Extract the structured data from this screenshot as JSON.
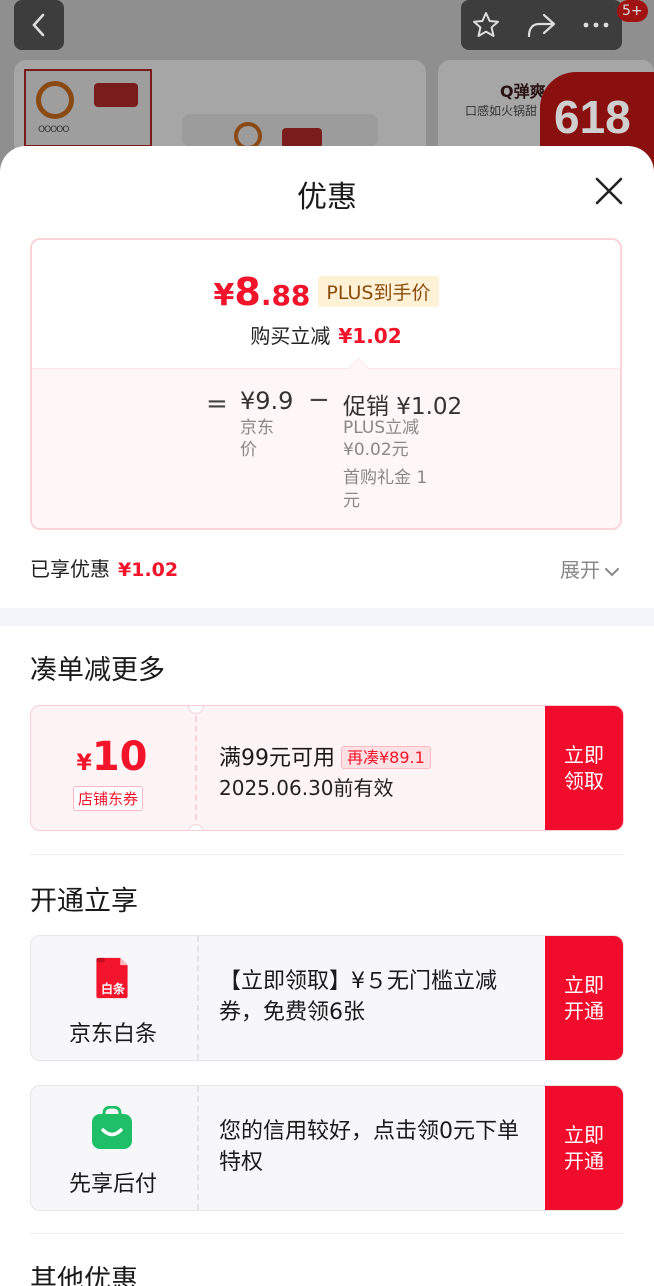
{
  "background": {
    "promo_title": "Q弹爽",
    "promo_sub": "口感如火锅甜",
    "badge": "618",
    "olympic_rings": "OOOOO",
    "notification_count": "5+"
  },
  "sheet": {
    "title": "优惠"
  },
  "summary": {
    "currency": "¥",
    "price_int": "8",
    "price_dec": ".88",
    "plus_tag": "PLUS到手价",
    "instant_cut_label": "购买立减",
    "instant_cut_value": "¥1.02",
    "equals": "=",
    "minus": "−",
    "orig_price": "¥9.9",
    "orig_label": "京东价",
    "promo_line": "促销 ¥1.02",
    "plus_cut": "PLUS立减 ¥0.02元",
    "gift": "首购礼金 1元"
  },
  "enjoyed": {
    "label": "已享优惠",
    "value": "¥1.02",
    "expand": "展开"
  },
  "sections": {
    "more_title": "凑单减更多",
    "open_title": "开通立享",
    "other_title": "其他优惠"
  },
  "coupon": {
    "symbol": "¥",
    "amount": "10",
    "type": "店铺东券",
    "condition": "满99元可用",
    "tag": "再凑¥89.1",
    "expiry": "2025.06.30前有效",
    "button": "立即领取"
  },
  "benefits": [
    {
      "icon_text": "白条",
      "name": "京东白条",
      "desc": "【立即领取】¥５无门槛立减券，免费领6张",
      "button": "立即开通",
      "color": "#f2142a"
    },
    {
      "name": "先享后付",
      "desc": "您的信用较好，点击领0元下单特权",
      "button": "立即开通",
      "color": "#1fbf6a"
    }
  ],
  "colors": {
    "accent": "#f2142a",
    "button": "#f20c2c",
    "plus_tag_bg": "#fff1d6"
  }
}
